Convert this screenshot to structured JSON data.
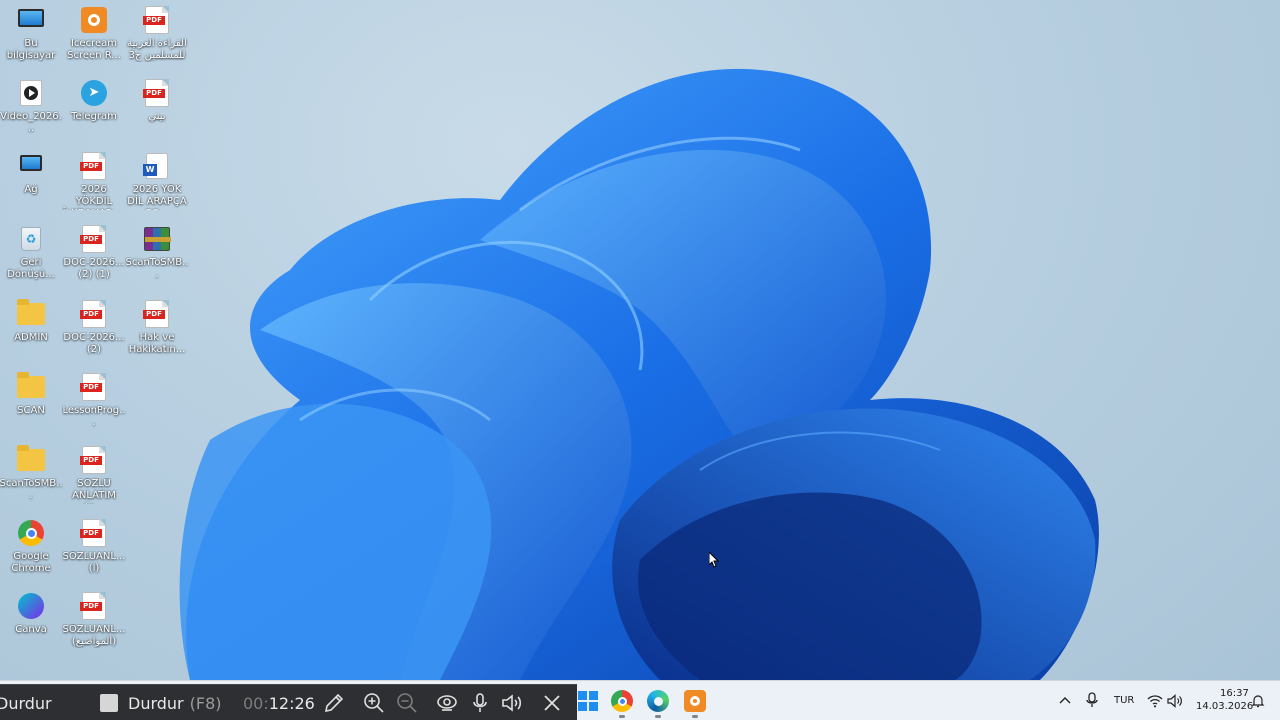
{
  "desktop": {
    "icons": [
      {
        "label": "Bu bilgisayar"
      },
      {
        "label": "Icecream Screen R..."
      },
      {
        "label": "القراءة العربية للمسلمين ج3"
      },
      {
        "label": "Video_2026..."
      },
      {
        "label": "Telegram"
      },
      {
        "label": "بيني"
      },
      {
        "label": "Ağ"
      },
      {
        "label": "2026 YÖKDİL İLKBAHAR ..."
      },
      {
        "label": "2026 YÖK DİL ARAPÇA SO..."
      },
      {
        "label": "Geri Dönüşü..."
      },
      {
        "label": "DOC-2026... (2) (1)"
      },
      {
        "label": "ScanToSMB..."
      },
      {
        "label": "ADMIN"
      },
      {
        "label": "DOC-2026... (2)"
      },
      {
        "label": "Hak ve Hakikatin..."
      },
      {
        "label": "SCAN"
      },
      {
        "label": "LessonProg..."
      },
      {
        "label": "ScanToSMB..."
      },
      {
        "label": "SÖZLÜ ANLATIM (o..."
      },
      {
        "label": "Google Chrome"
      },
      {
        "label": "SÖZLUANL... (l)"
      },
      {
        "label": "Canva"
      },
      {
        "label": "SÖZLUANL... (المواضيع)"
      }
    ],
    "pdf_tag": "PDF",
    "word_tag": "W"
  },
  "recorder": {
    "stop_label": "Durdur",
    "pause_label": "Durdur",
    "pause_hotkey": "(F8)",
    "timer_hours": "00:",
    "timer_rest": "12:26"
  },
  "tray": {
    "language": "TUR",
    "time": "16:37",
    "date": "14.03.2026"
  },
  "colors": {
    "accent_blue": "#1f6fe0",
    "recorder_bg": "#2e2f32",
    "pdf_red": "#d9251d"
  }
}
